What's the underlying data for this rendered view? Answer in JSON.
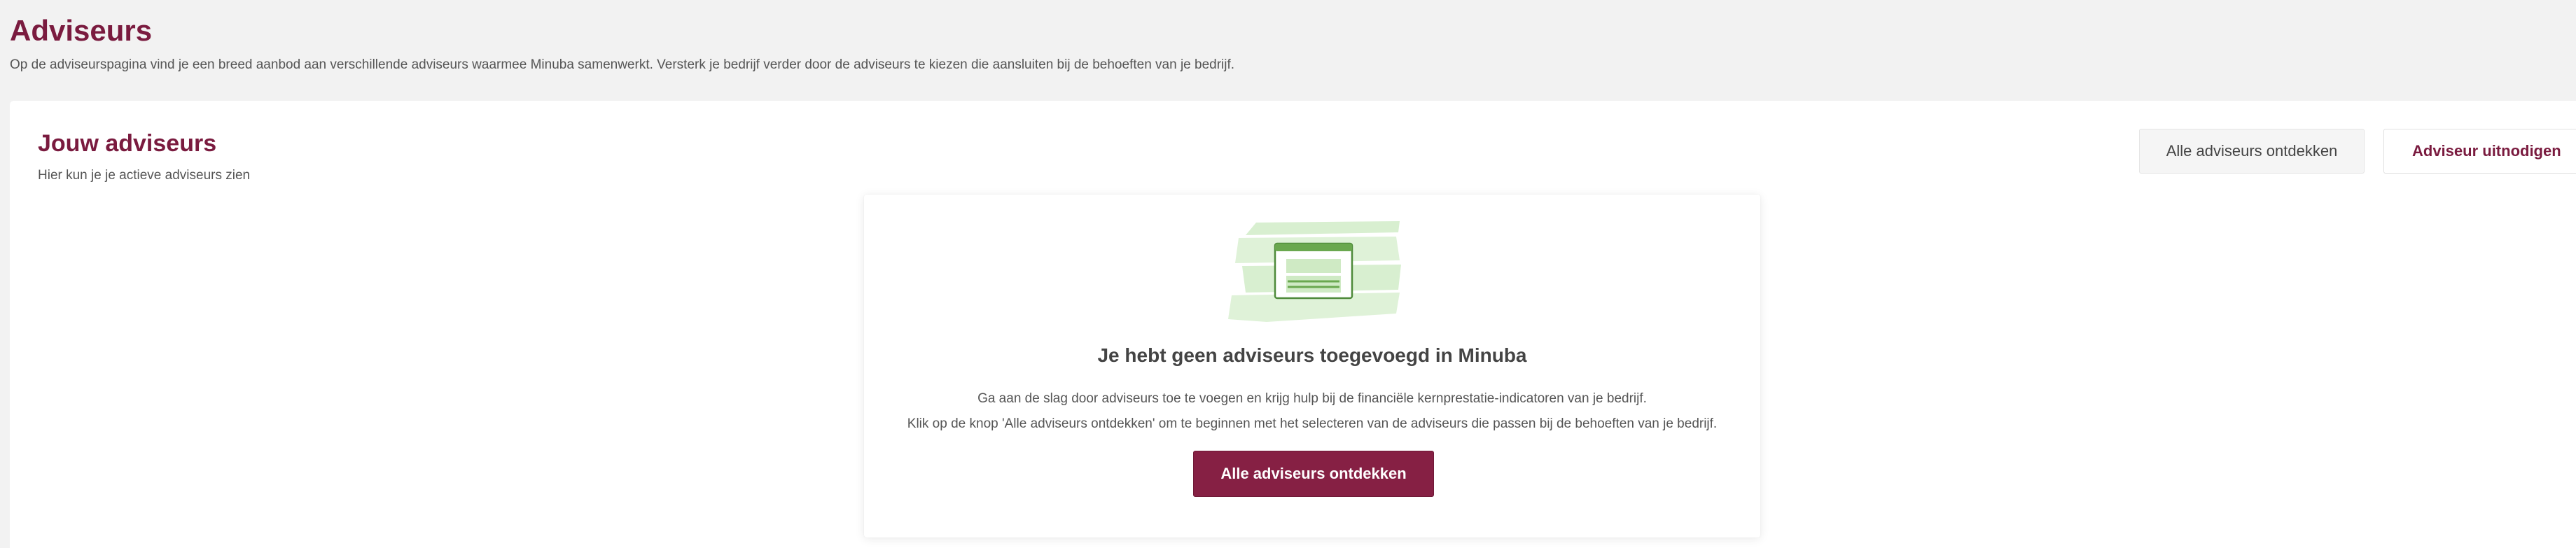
{
  "header": {
    "title": "Adviseurs",
    "intro": "Op de adviseurspagina vind je een breed aanbod aan verschillende adviseurs waarmee Minuba samenwerkt. Versterk je bedrijf verder door de adviseurs te kiezen die aansluiten bij de behoeften van je bedrijf."
  },
  "section": {
    "title": "Jouw adviseurs",
    "subtitle": "Hier kun je je actieve adviseurs zien"
  },
  "actions": {
    "discover_label": "Alle adviseurs ontdekken",
    "invite_label": "Adviseur uitnodigen"
  },
  "empty_state": {
    "illustration": "browser-window-illustration",
    "title": "Je hebt geen adviseurs toegevoegd in Minuba",
    "line1": "Ga aan de slag door adviseurs toe te voegen en krijg hulp bij de financiële kernprestatie-indicatoren van je bedrijf.",
    "line2": "Klik op de knop 'Alle adviseurs ontdekken' om te beginnen met het selecteren van de adviseurs die passen bij de behoeften van je bedrijf.",
    "button_label": "Alle adviseurs ontdekken"
  },
  "colors": {
    "brand": "#7a1b3f",
    "primary_button": "#862044",
    "background": "#f2f2f2",
    "illustration_green": "#6aa84f"
  }
}
